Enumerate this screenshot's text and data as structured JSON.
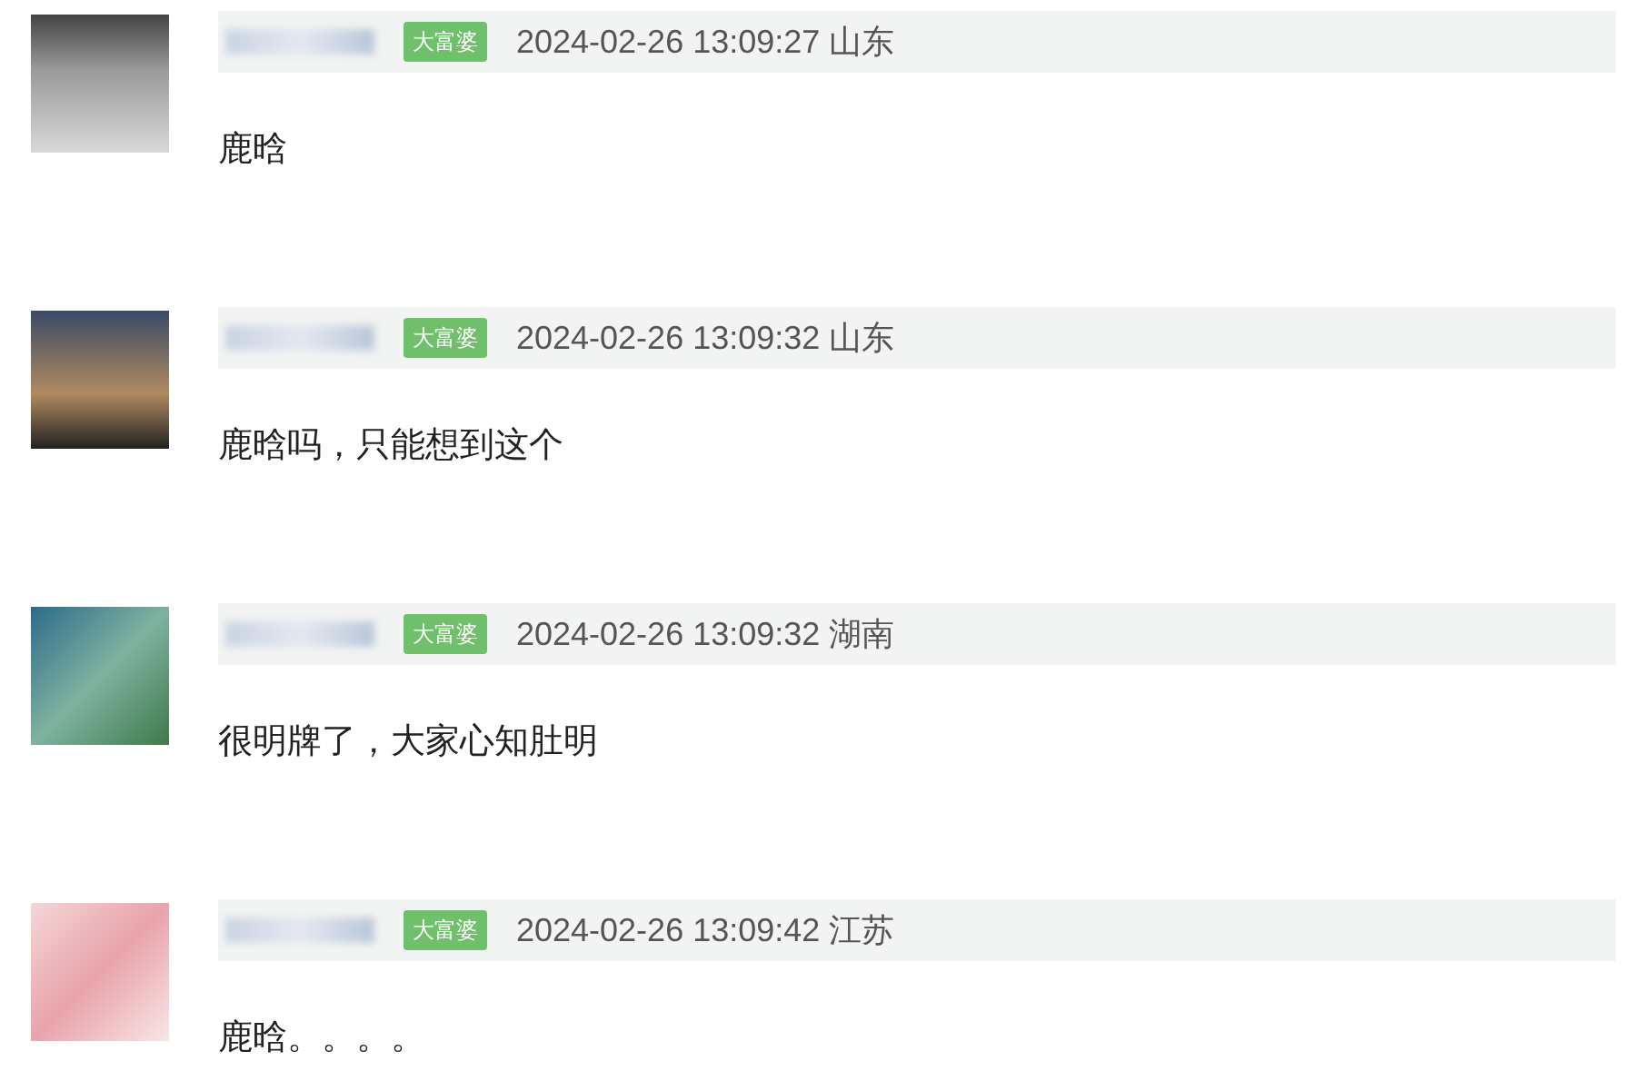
{
  "comments": [
    {
      "badge": "大富婆",
      "time": "2024-02-26 13:09:27",
      "region": "山东",
      "text": "鹿晗"
    },
    {
      "badge": "大富婆",
      "time": "2024-02-26 13:09:32",
      "region": "山东",
      "text": "鹿晗吗，只能想到这个"
    },
    {
      "badge": "大富婆",
      "time": "2024-02-26 13:09:32",
      "region": "湖南",
      "text": "很明牌了，大家心知肚明"
    },
    {
      "badge": "大富婆",
      "time": "2024-02-26 13:09:42",
      "region": "江苏",
      "text": "鹿晗。。。。"
    }
  ]
}
